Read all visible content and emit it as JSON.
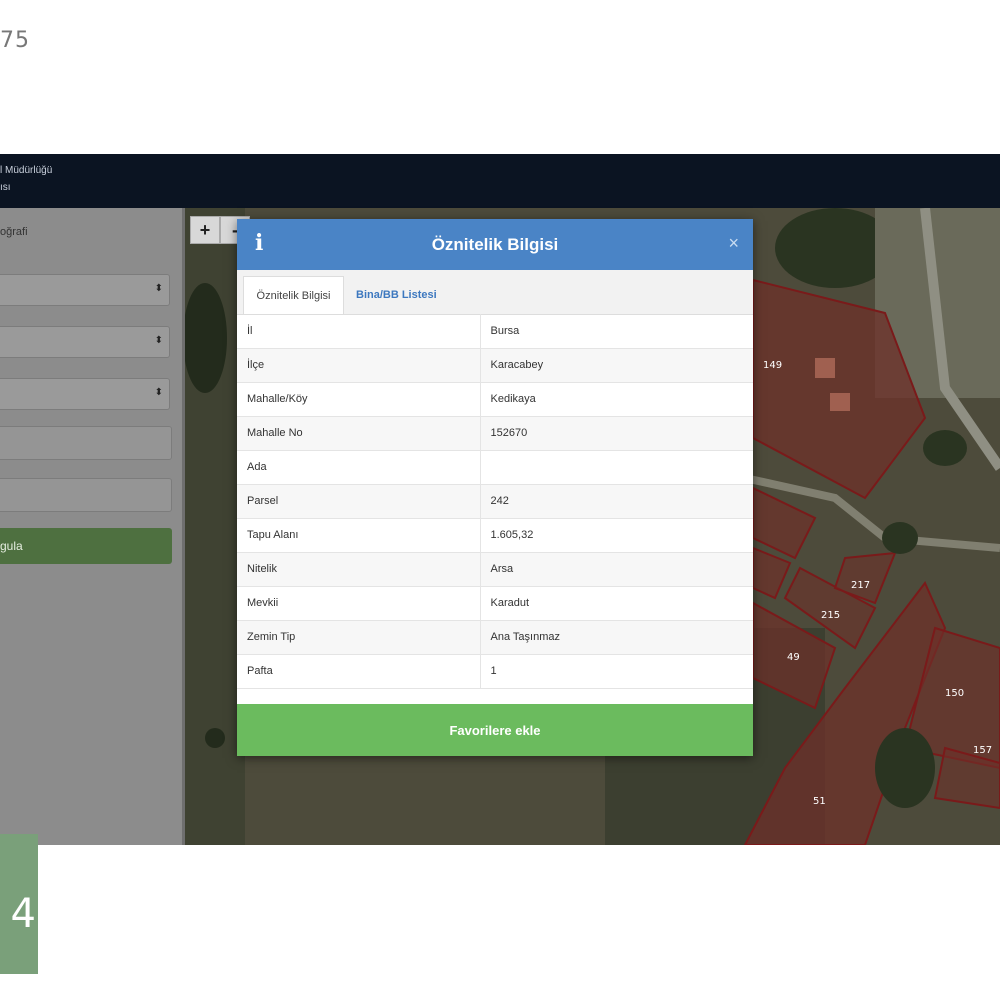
{
  "corner_text": "75",
  "badge_text": "4",
  "topbar": {
    "line1": "l Müdürlüğü",
    "line2": "ısı"
  },
  "sidebar": {
    "title": "oğrafi",
    "button_label": "gula"
  },
  "map": {
    "zoom_in": "+",
    "zoom_out": "-",
    "parcel_labels": [
      "149",
      "217",
      "215",
      "49",
      "150",
      "157",
      "51"
    ]
  },
  "modal": {
    "title": "Öznitelik Bilgisi",
    "info_icon": "i",
    "close_icon": "×",
    "tabs": [
      {
        "label": "Öznitelik Bilgisi",
        "active": true
      },
      {
        "label": "Bina/BB Listesi",
        "active": false
      }
    ],
    "rows": [
      {
        "key": "İl",
        "value": "Bursa"
      },
      {
        "key": "İlçe",
        "value": "Karacabey"
      },
      {
        "key": "Mahalle/Köy",
        "value": "Kedikaya"
      },
      {
        "key": "Mahalle No",
        "value": "152670"
      },
      {
        "key": "Ada",
        "value": ""
      },
      {
        "key": "Parsel",
        "value": "242"
      },
      {
        "key": "Tapu Alanı",
        "value": "1.605,32"
      },
      {
        "key": "Nitelik",
        "value": "Arsa"
      },
      {
        "key": "Mevkii",
        "value": "Karadut"
      },
      {
        "key": "Zemin Tip",
        "value": "Ana Taşınmaz"
      },
      {
        "key": "Pafta",
        "value": "1"
      }
    ],
    "favorite_button": "Favorilere ekle"
  },
  "colors": {
    "header_blue": "#4a84c6",
    "favorite_green": "#6bbb5e",
    "parcel_outline": "#7a1a1a"
  }
}
